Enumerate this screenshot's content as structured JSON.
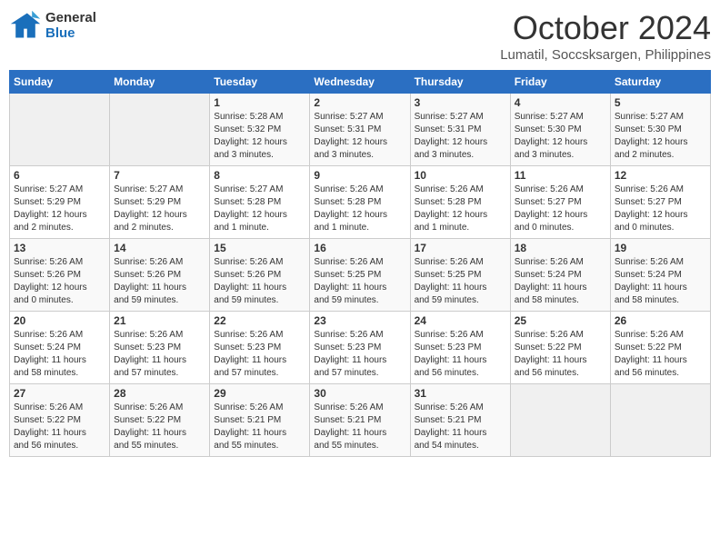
{
  "header": {
    "logo_line1": "General",
    "logo_line2": "Blue",
    "month": "October 2024",
    "location": "Lumatil, Soccsksargen, Philippines"
  },
  "calendar": {
    "days_of_week": [
      "Sunday",
      "Monday",
      "Tuesday",
      "Wednesday",
      "Thursday",
      "Friday",
      "Saturday"
    ],
    "weeks": [
      [
        {
          "day": "",
          "info": ""
        },
        {
          "day": "",
          "info": ""
        },
        {
          "day": "1",
          "info": "Sunrise: 5:28 AM\nSunset: 5:32 PM\nDaylight: 12 hours\nand 3 minutes."
        },
        {
          "day": "2",
          "info": "Sunrise: 5:27 AM\nSunset: 5:31 PM\nDaylight: 12 hours\nand 3 minutes."
        },
        {
          "day": "3",
          "info": "Sunrise: 5:27 AM\nSunset: 5:31 PM\nDaylight: 12 hours\nand 3 minutes."
        },
        {
          "day": "4",
          "info": "Sunrise: 5:27 AM\nSunset: 5:30 PM\nDaylight: 12 hours\nand 3 minutes."
        },
        {
          "day": "5",
          "info": "Sunrise: 5:27 AM\nSunset: 5:30 PM\nDaylight: 12 hours\nand 2 minutes."
        }
      ],
      [
        {
          "day": "6",
          "info": "Sunrise: 5:27 AM\nSunset: 5:29 PM\nDaylight: 12 hours\nand 2 minutes."
        },
        {
          "day": "7",
          "info": "Sunrise: 5:27 AM\nSunset: 5:29 PM\nDaylight: 12 hours\nand 2 minutes."
        },
        {
          "day": "8",
          "info": "Sunrise: 5:27 AM\nSunset: 5:28 PM\nDaylight: 12 hours\nand 1 minute."
        },
        {
          "day": "9",
          "info": "Sunrise: 5:26 AM\nSunset: 5:28 PM\nDaylight: 12 hours\nand 1 minute."
        },
        {
          "day": "10",
          "info": "Sunrise: 5:26 AM\nSunset: 5:28 PM\nDaylight: 12 hours\nand 1 minute."
        },
        {
          "day": "11",
          "info": "Sunrise: 5:26 AM\nSunset: 5:27 PM\nDaylight: 12 hours\nand 0 minutes."
        },
        {
          "day": "12",
          "info": "Sunrise: 5:26 AM\nSunset: 5:27 PM\nDaylight: 12 hours\nand 0 minutes."
        }
      ],
      [
        {
          "day": "13",
          "info": "Sunrise: 5:26 AM\nSunset: 5:26 PM\nDaylight: 12 hours\nand 0 minutes."
        },
        {
          "day": "14",
          "info": "Sunrise: 5:26 AM\nSunset: 5:26 PM\nDaylight: 11 hours\nand 59 minutes."
        },
        {
          "day": "15",
          "info": "Sunrise: 5:26 AM\nSunset: 5:26 PM\nDaylight: 11 hours\nand 59 minutes."
        },
        {
          "day": "16",
          "info": "Sunrise: 5:26 AM\nSunset: 5:25 PM\nDaylight: 11 hours\nand 59 minutes."
        },
        {
          "day": "17",
          "info": "Sunrise: 5:26 AM\nSunset: 5:25 PM\nDaylight: 11 hours\nand 59 minutes."
        },
        {
          "day": "18",
          "info": "Sunrise: 5:26 AM\nSunset: 5:24 PM\nDaylight: 11 hours\nand 58 minutes."
        },
        {
          "day": "19",
          "info": "Sunrise: 5:26 AM\nSunset: 5:24 PM\nDaylight: 11 hours\nand 58 minutes."
        }
      ],
      [
        {
          "day": "20",
          "info": "Sunrise: 5:26 AM\nSunset: 5:24 PM\nDaylight: 11 hours\nand 58 minutes."
        },
        {
          "day": "21",
          "info": "Sunrise: 5:26 AM\nSunset: 5:23 PM\nDaylight: 11 hours\nand 57 minutes."
        },
        {
          "day": "22",
          "info": "Sunrise: 5:26 AM\nSunset: 5:23 PM\nDaylight: 11 hours\nand 57 minutes."
        },
        {
          "day": "23",
          "info": "Sunrise: 5:26 AM\nSunset: 5:23 PM\nDaylight: 11 hours\nand 57 minutes."
        },
        {
          "day": "24",
          "info": "Sunrise: 5:26 AM\nSunset: 5:23 PM\nDaylight: 11 hours\nand 56 minutes."
        },
        {
          "day": "25",
          "info": "Sunrise: 5:26 AM\nSunset: 5:22 PM\nDaylight: 11 hours\nand 56 minutes."
        },
        {
          "day": "26",
          "info": "Sunrise: 5:26 AM\nSunset: 5:22 PM\nDaylight: 11 hours\nand 56 minutes."
        }
      ],
      [
        {
          "day": "27",
          "info": "Sunrise: 5:26 AM\nSunset: 5:22 PM\nDaylight: 11 hours\nand 56 minutes."
        },
        {
          "day": "28",
          "info": "Sunrise: 5:26 AM\nSunset: 5:22 PM\nDaylight: 11 hours\nand 55 minutes."
        },
        {
          "day": "29",
          "info": "Sunrise: 5:26 AM\nSunset: 5:21 PM\nDaylight: 11 hours\nand 55 minutes."
        },
        {
          "day": "30",
          "info": "Sunrise: 5:26 AM\nSunset: 5:21 PM\nDaylight: 11 hours\nand 55 minutes."
        },
        {
          "day": "31",
          "info": "Sunrise: 5:26 AM\nSunset: 5:21 PM\nDaylight: 11 hours\nand 54 minutes."
        },
        {
          "day": "",
          "info": ""
        },
        {
          "day": "",
          "info": ""
        }
      ]
    ]
  }
}
